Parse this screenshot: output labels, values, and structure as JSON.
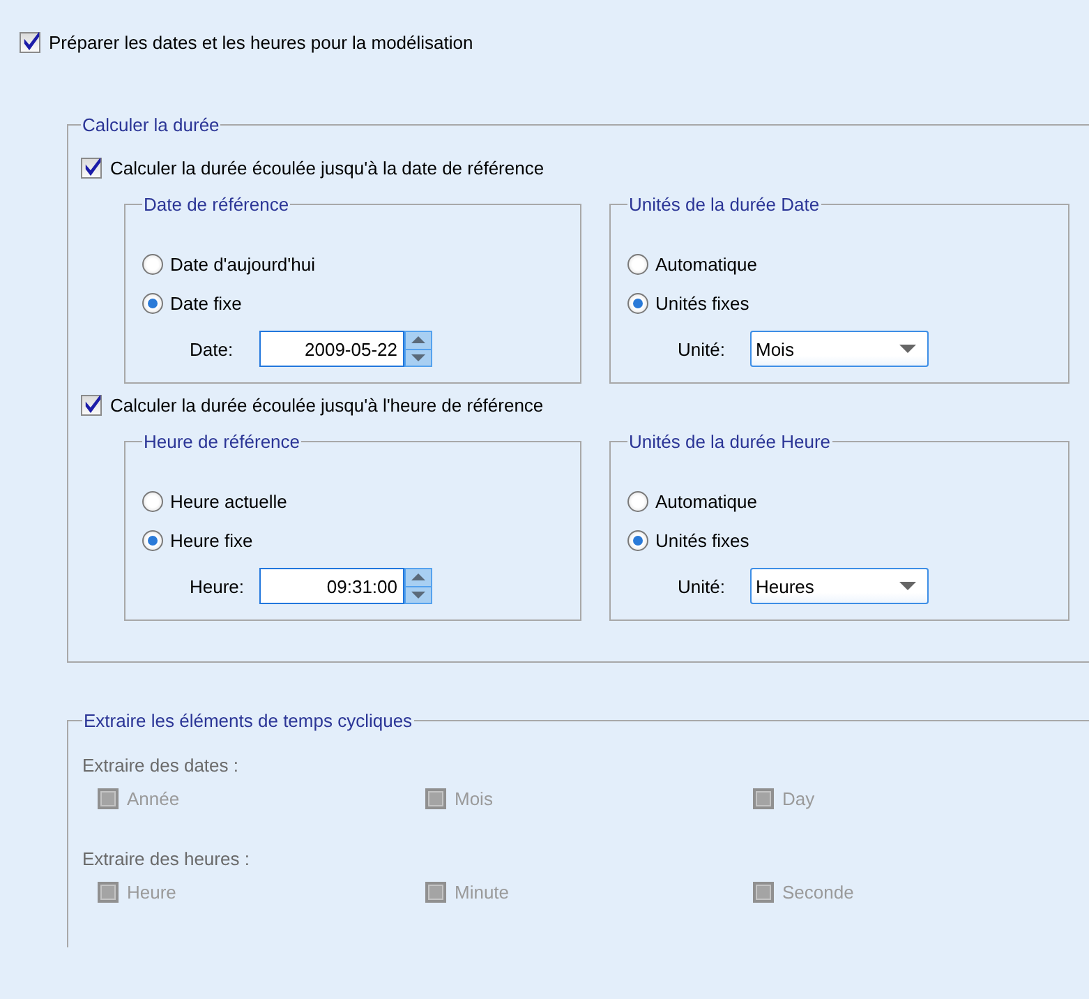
{
  "prepare": {
    "label": "Préparer les dates et les heures pour la modélisation",
    "checked": true
  },
  "duration": {
    "title": "Calculer la durée",
    "sections": [
      {
        "label": "Calculer la durée écoulée jusqu'à la date de référence",
        "checked": true,
        "reference": {
          "title": "Date de référence",
          "options": [
            {
              "label": "Date d'aujourd'hui",
              "selected": false
            },
            {
              "label": "Date fixe",
              "selected": true
            }
          ],
          "field": {
            "label": "Date:",
            "value": "2009-05-22"
          }
        },
        "units": {
          "title": "Unités de la durée Date",
          "options": [
            {
              "label": "Automatique",
              "selected": false
            },
            {
              "label": "Unités fixes",
              "selected": true
            }
          ],
          "unit": {
            "label": "Unité:",
            "value": "Mois"
          }
        }
      },
      {
        "label": "Calculer la durée écoulée jusqu'à l'heure de référence",
        "checked": true,
        "reference": {
          "title": "Heure de référence",
          "options": [
            {
              "label": "Heure actuelle",
              "selected": false
            },
            {
              "label": "Heure fixe",
              "selected": true
            }
          ],
          "field": {
            "label": "Heure:",
            "value": "09:31:00"
          }
        },
        "units": {
          "title": "Unités de la durée Heure",
          "options": [
            {
              "label": "Automatique",
              "selected": false
            },
            {
              "label": "Unités fixes",
              "selected": true
            }
          ],
          "unit": {
            "label": "Unité:",
            "value": "Heures"
          }
        }
      }
    ]
  },
  "cyclic": {
    "title": "Extraire les éléments de temps cycliques",
    "groups": [
      {
        "label": "Extraire des dates :",
        "items": [
          {
            "label": "Année",
            "checked": false,
            "disabled": true
          },
          {
            "label": "Mois",
            "checked": false,
            "disabled": true
          },
          {
            "label": "Day",
            "checked": false,
            "disabled": true
          }
        ]
      },
      {
        "label": "Extraire des heures :",
        "items": [
          {
            "label": "Heure",
            "checked": false,
            "disabled": true
          },
          {
            "label": "Minute",
            "checked": false,
            "disabled": true
          },
          {
            "label": "Seconde",
            "checked": false,
            "disabled": true
          }
        ]
      }
    ]
  }
}
